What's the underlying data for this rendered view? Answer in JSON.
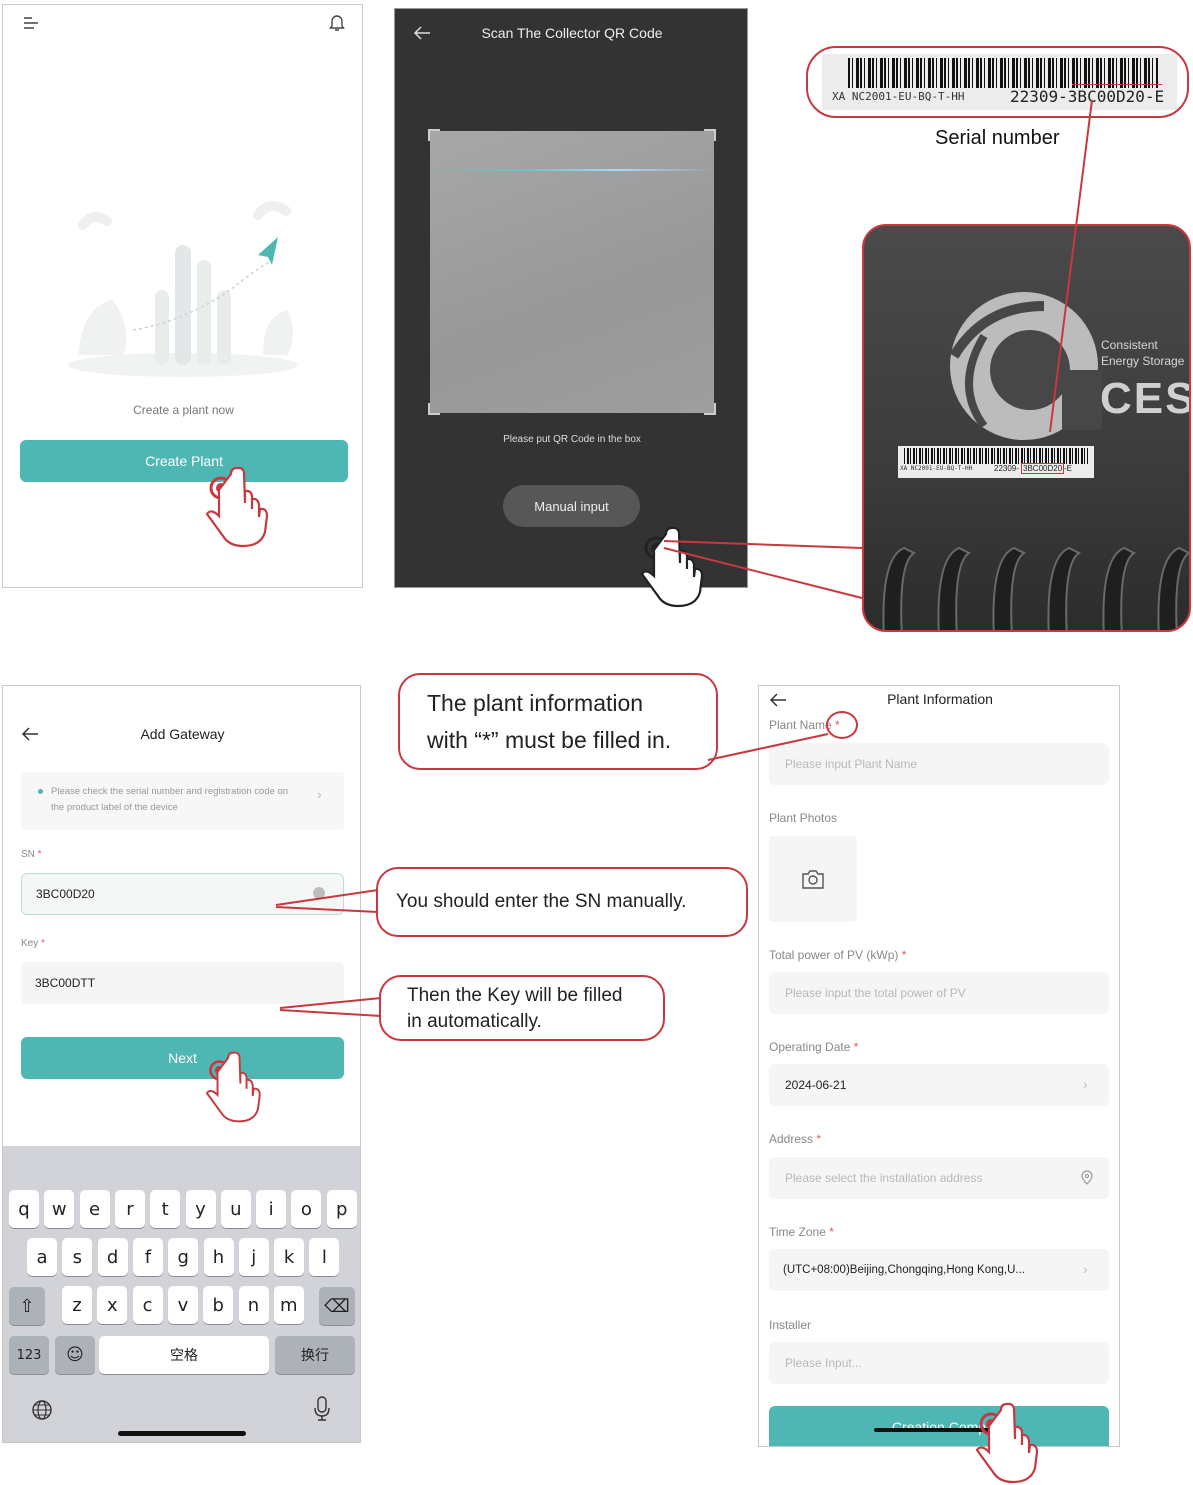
{
  "screen1": {
    "empty_text": "Create a plant now",
    "create_button": "Create Plant"
  },
  "screen2": {
    "title": "Scan The Collector QR Code",
    "hint": "Please put QR Code in the box",
    "manual_button": "Manual input"
  },
  "label_photo": {
    "barcode_left": "XA NC2001-EU-BQ-T-HH",
    "barcode_right": "22309-3BC00D20-E",
    "caption": "Serial number",
    "device_text_1": "Consistent",
    "device_text_2": "Energy Storage",
    "device_logo": "CES",
    "small_left": "XA NC2001-EU-BQ-T-HH",
    "small_mid": "22309-",
    "small_box": "3BC00D20",
    "small_end": "-E"
  },
  "screen3": {
    "title": "Add Gateway",
    "notice": "Please check the serial number and registration code on the product label of the device",
    "sn_label": "SN",
    "sn_value": "3BC00D20",
    "key_label": "Key",
    "key_value": "3BC00DTT",
    "next_button": "Next",
    "keyboard": {
      "row1": [
        "q",
        "w",
        "e",
        "r",
        "t",
        "y",
        "u",
        "i",
        "o",
        "p"
      ],
      "row2": [
        "a",
        "s",
        "d",
        "f",
        "g",
        "h",
        "j",
        "k",
        "l"
      ],
      "row3": [
        "z",
        "x",
        "c",
        "v",
        "b",
        "n",
        "m"
      ],
      "num_key": "123",
      "space_key": "空格",
      "return_key": "换行"
    }
  },
  "callouts": {
    "required": "The plant information with “*” must be filled in.",
    "required_line1": "The plant information",
    "required_line2": "with “*” must be filled in.",
    "sn": "You should enter the SN manually.",
    "key_line1": "Then the Key will be filled",
    "key_line2": "in automatically."
  },
  "screen4": {
    "title": "Plant Information",
    "plant_name_label": "Plant Name",
    "plant_name_placeholder": "Please input Plant Name",
    "photos_label": "Plant Photos",
    "pv_label": "Total power of PV (kWp)",
    "pv_placeholder": "Please input the total power of PV",
    "date_label": "Operating Date",
    "date_value": "2024-06-21",
    "address_label": "Address",
    "address_placeholder": "Please select the installation address",
    "tz_label": "Time Zone",
    "tz_value": "(UTC+08:00)Beijing,Chongqing,Hong Kong,U...",
    "installer_label": "Installer",
    "installer_placeholder": "Please Input...",
    "submit_button": "Creation Comp"
  },
  "colors": {
    "teal": "#4fb7b3",
    "callout_red": "#c8383f",
    "dark_bg": "#333333"
  }
}
